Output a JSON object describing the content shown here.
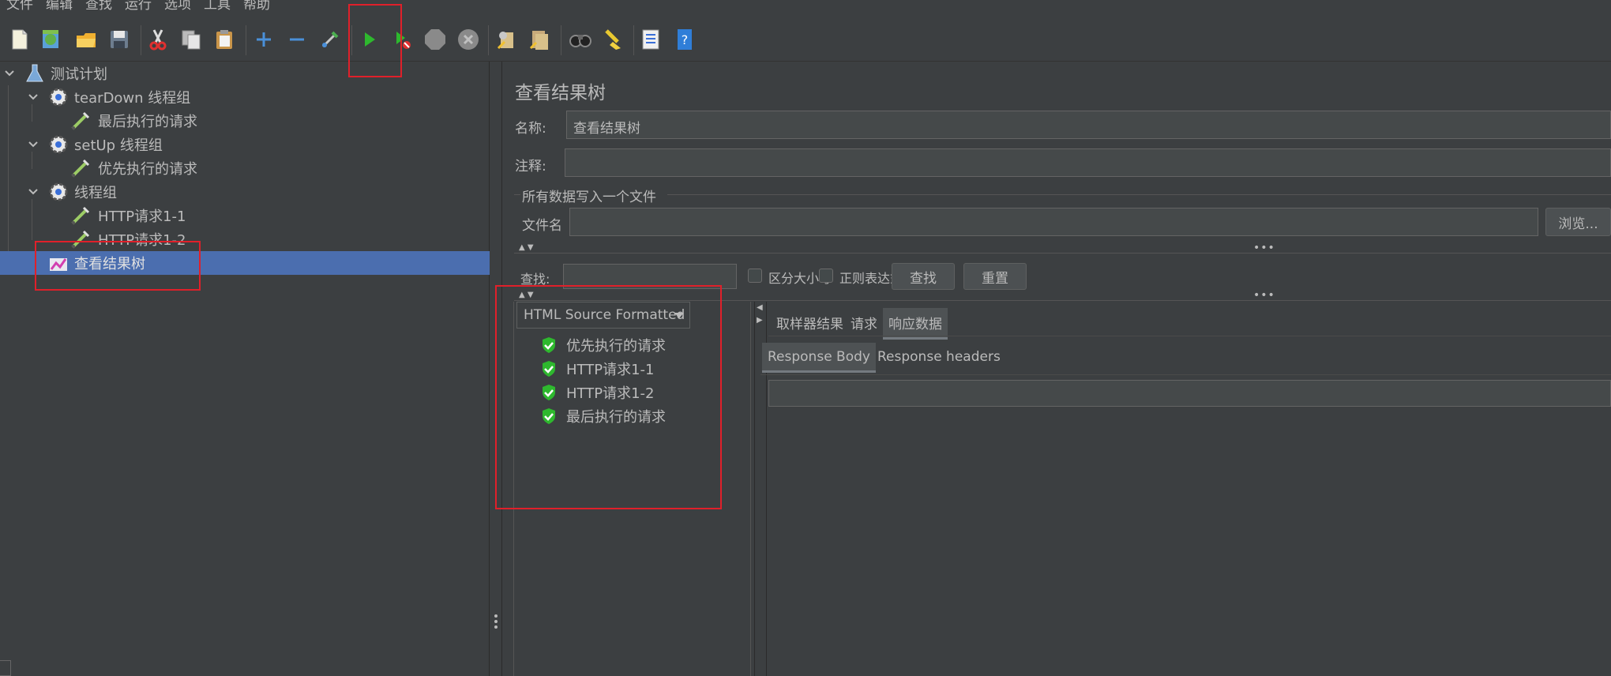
{
  "menu": [
    "文件",
    "编辑",
    "查找",
    "运行",
    "选项",
    "工具",
    "帮助"
  ],
  "toolbar": [
    {
      "name": "new-icon"
    },
    {
      "name": "templates-icon"
    },
    {
      "name": "open-icon"
    },
    {
      "name": "save-icon"
    },
    {
      "name": "cut-icon"
    },
    {
      "name": "copy-icon"
    },
    {
      "name": "paste-icon"
    },
    {
      "name": "expand-icon"
    },
    {
      "name": "collapse-icon"
    },
    {
      "name": "toggle-icon"
    },
    {
      "name": "start-icon"
    },
    {
      "name": "start-no-pauses-icon"
    },
    {
      "name": "stop-icon"
    },
    {
      "name": "shutdown-icon"
    },
    {
      "name": "clear-icon"
    },
    {
      "name": "clear-all-icon"
    },
    {
      "name": "search-icon"
    },
    {
      "name": "reset-search-icon"
    },
    {
      "name": "function-helper-icon"
    },
    {
      "name": "help-icon"
    }
  ],
  "tree": {
    "items": [
      {
        "label": "测试计划",
        "icon": "flask-icon"
      },
      {
        "label": "tearDown 线程组",
        "icon": "gear-icon"
      },
      {
        "label": "最后执行的请求",
        "icon": "sampler-icon"
      },
      {
        "label": "setUp 线程组",
        "icon": "gear-icon"
      },
      {
        "label": "优先执行的请求",
        "icon": "sampler-icon"
      },
      {
        "label": "线程组",
        "icon": "gear-icon"
      },
      {
        "label": "HTTP请求1-1",
        "icon": "sampler-icon"
      },
      {
        "label": "HTTP请求1-2",
        "icon": "sampler-icon"
      },
      {
        "label": "查看结果树",
        "icon": "listener-icon",
        "selected": true
      }
    ]
  },
  "panel": {
    "title": "查看结果树",
    "name_label": "名称:",
    "name_value": "查看结果树",
    "comment_label": "注释:",
    "comment_value": "",
    "file_group": "所有数据写入一个文件",
    "filename_label": "文件名",
    "filename_value": "",
    "browse": "浏览...",
    "search_label": "查找:",
    "search_value": "",
    "case_sensitive": "区分大小写",
    "regex": "正则表达式",
    "find": "查找",
    "reset": "重置",
    "renderer": "HTML Source Formatted",
    "results": [
      "优先执行的请求",
      "HTTP请求1-1",
      "HTTP请求1-2",
      "最后执行的请求"
    ],
    "tabs": [
      "取样器结果",
      "请求",
      "响应数据"
    ],
    "active_tab": "响应数据",
    "subtabs": [
      "Response Body",
      "Response headers"
    ],
    "active_subtab": "Response Body",
    "response_body": ""
  },
  "colors": {
    "background": "#3c3f41",
    "selection": "#4b6eaf",
    "annotation": "#e0202a",
    "success": "#2eb82e"
  }
}
